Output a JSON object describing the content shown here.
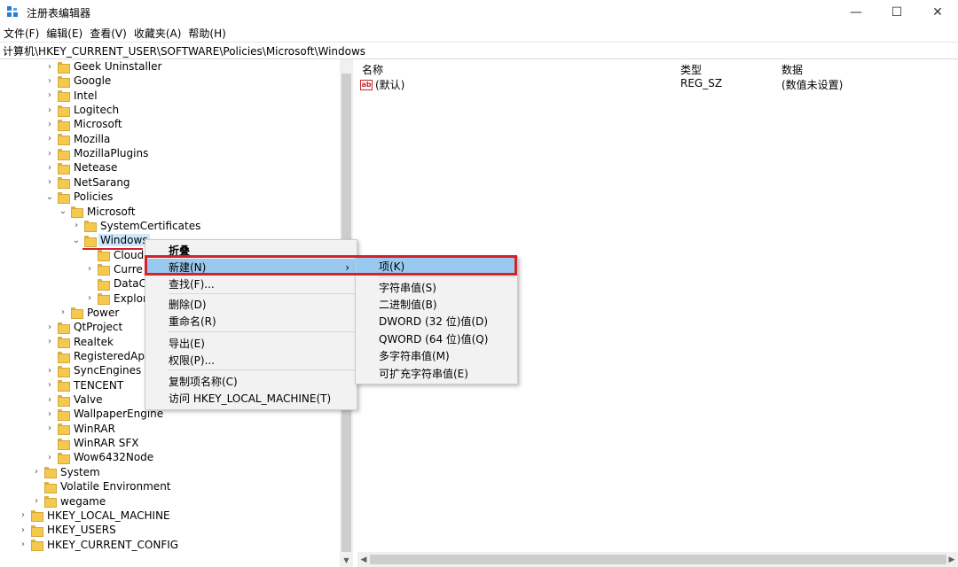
{
  "window": {
    "title": "注册表编辑器",
    "controls": [
      "—",
      "☐",
      "✕"
    ]
  },
  "menubar": [
    "文件(F)",
    "编辑(E)",
    "查看(V)",
    "收藏夹(A)",
    "帮助(H)"
  ],
  "address": "计算机\\HKEY_CURRENT_USER\\SOFTWARE\\Policies\\Microsoft\\Windows",
  "tree": [
    {
      "label": "Geek Uninstaller",
      "arrow": "›",
      "level": 3
    },
    {
      "label": "Google",
      "arrow": "›",
      "level": 3
    },
    {
      "label": "Intel",
      "arrow": "›",
      "level": 3
    },
    {
      "label": "Logitech",
      "arrow": "›",
      "level": 3
    },
    {
      "label": "Microsoft",
      "arrow": "›",
      "level": 3
    },
    {
      "label": "Mozilla",
      "arrow": "›",
      "level": 3
    },
    {
      "label": "MozillaPlugins",
      "arrow": "›",
      "level": 3
    },
    {
      "label": "Netease",
      "arrow": "›",
      "level": 3
    },
    {
      "label": "NetSarang",
      "arrow": "›",
      "level": 3
    },
    {
      "label": "Policies",
      "arrow": "⌄",
      "level": 3
    },
    {
      "label": "Microsoft",
      "arrow": "⌄",
      "level": 4
    },
    {
      "label": "SystemCertificates",
      "arrow": "›",
      "level": 5
    },
    {
      "label": "Windows",
      "arrow": "⌄",
      "level": 5,
      "selected": true
    },
    {
      "label": "Cloud",
      "arrow": "",
      "level": 6
    },
    {
      "label": "Curre",
      "arrow": "›",
      "level": 6
    },
    {
      "label": "DataC",
      "arrow": "",
      "level": 6
    },
    {
      "label": "Explor",
      "arrow": "›",
      "level": 6
    },
    {
      "label": "Power",
      "arrow": "›",
      "level": 4
    },
    {
      "label": "QtProject",
      "arrow": "›",
      "level": 3
    },
    {
      "label": "Realtek",
      "arrow": "›",
      "level": 3
    },
    {
      "label": "RegisteredApp",
      "arrow": "",
      "level": 3
    },
    {
      "label": "SyncEngines",
      "arrow": "›",
      "level": 3
    },
    {
      "label": "TENCENT",
      "arrow": "›",
      "level": 3
    },
    {
      "label": "Valve",
      "arrow": "›",
      "level": 3
    },
    {
      "label": "WallpaperEngine",
      "arrow": "›",
      "level": 3
    },
    {
      "label": "WinRAR",
      "arrow": "›",
      "level": 3
    },
    {
      "label": "WinRAR SFX",
      "arrow": "",
      "level": 3
    },
    {
      "label": "Wow6432Node",
      "arrow": "›",
      "level": 3
    },
    {
      "label": "System",
      "arrow": "›",
      "level": 2
    },
    {
      "label": "Volatile Environment",
      "arrow": "",
      "level": 2
    },
    {
      "label": "wegame",
      "arrow": "›",
      "level": 2
    },
    {
      "label": "HKEY_LOCAL_MACHINE",
      "arrow": "›",
      "level": 1
    },
    {
      "label": "HKEY_USERS",
      "arrow": "›",
      "level": 1
    },
    {
      "label": "HKEY_CURRENT_CONFIG",
      "arrow": "›",
      "level": 1
    }
  ],
  "values_pane": {
    "headers": {
      "name": "名称",
      "type": "类型",
      "data": "数据"
    },
    "rows": [
      {
        "icon": "ab",
        "name": "(默认)",
        "type": "REG_SZ",
        "data": "(数值未设置)"
      }
    ]
  },
  "context_menu": {
    "items": [
      "折叠",
      "新建(N)",
      "查找(F)...",
      "删除(D)",
      "重命名(R)",
      "导出(E)",
      "权限(P)...",
      "复制项名称(C)",
      "访问 HKEY_LOCAL_MACHINE(T)"
    ],
    "submenu_arrow": "›",
    "highlighted": "新建(N)"
  },
  "submenu": {
    "items": [
      "项(K)",
      "字符串值(S)",
      "二进制值(B)",
      "DWORD (32 位)值(D)",
      "QWORD (64 位)值(Q)",
      "多字符串值(M)",
      "可扩充字符串值(E)"
    ],
    "highlighted": "项(K)"
  },
  "colors": {
    "highlight": "#99c9ef",
    "selection": "#cce8ff",
    "annotation_red": "#d3222a"
  }
}
